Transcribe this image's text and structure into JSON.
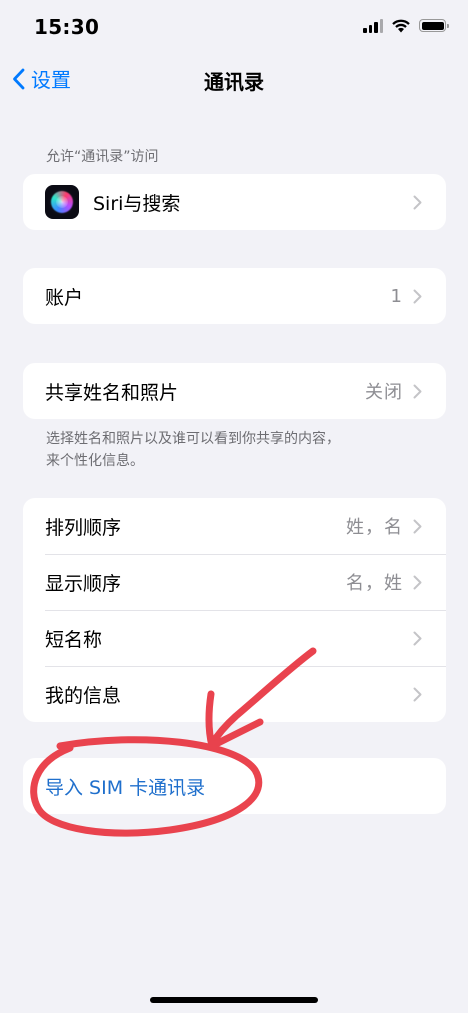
{
  "status_bar": {
    "time": "15:30"
  },
  "nav": {
    "back_label": "设置",
    "title": "通讯录"
  },
  "section_access": {
    "header": "允许“通讯录”访问",
    "items": [
      {
        "label": "Siri与搜索",
        "icon": "siri-icon"
      }
    ]
  },
  "accounts": {
    "label": "账户",
    "value": "1"
  },
  "share": {
    "label": "共享姓名和照片",
    "value": "关闭",
    "footer_line1": "选择姓名和照片以及谁可以看到你共享的内容，",
    "footer_line2": "来个性化信息。"
  },
  "order_group": {
    "items": [
      {
        "label": "排列顺序",
        "value": "姓，名"
      },
      {
        "label": "显示顺序",
        "value": "名，姓"
      },
      {
        "label": "短名称",
        "value": ""
      },
      {
        "label": "我的信息",
        "value": ""
      }
    ]
  },
  "import": {
    "label": "导入 SIM 卡通讯录"
  },
  "colors": {
    "accent": "#007aff",
    "link": "#1f6fcc",
    "annotation": "#e8343f",
    "background": "#f2f2f7"
  }
}
